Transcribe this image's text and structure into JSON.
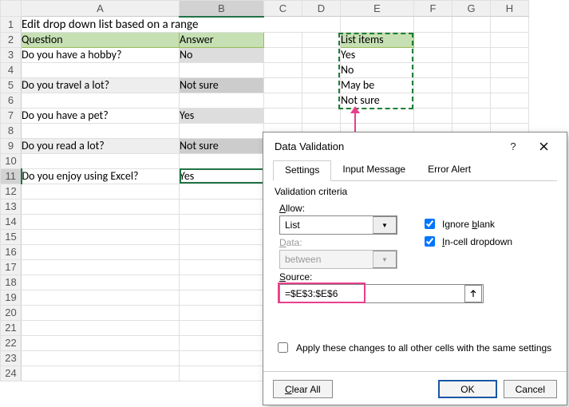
{
  "sheet": {
    "title": "Edit drop down list based on a range",
    "columns": [
      "A",
      "B",
      "C",
      "D",
      "E",
      "F",
      "G",
      "H"
    ],
    "rows_visible": 24,
    "headers": {
      "A2": "Question",
      "B2": "Answer",
      "E2": "List items"
    },
    "questions": {
      "A3": "Do you have a hobby?",
      "A5": "Do you travel a lot?",
      "A7": "Do you have a pet?",
      "A9": "Do you read a lot?",
      "A11": "Do you enjoy using Excel?"
    },
    "answers": {
      "B3": "No",
      "B5": "Not sure",
      "B7": "Yes",
      "B9": "Not sure",
      "B11": "Yes"
    },
    "list_items": {
      "E3": "Yes",
      "E4": "No",
      "E5": "May be",
      "E6": "Not sure"
    },
    "active_cell": "B11",
    "marching_range": "E3:E6"
  },
  "dialog": {
    "title": "Data Validation",
    "help_label": "?",
    "tabs": {
      "settings": "Settings",
      "input_message": "Input Message",
      "error_alert": "Error Alert"
    },
    "active_tab": "settings",
    "criteria_label": "Validation criteria",
    "allow_label_pre": "A",
    "allow_label_post": "llow:",
    "allow_value": "List",
    "data_label_pre": "D",
    "data_label_post": "ata:",
    "data_value": "between",
    "ignore_blank": true,
    "ignore_blank_pre": "Ignore ",
    "ignore_blank_u": "b",
    "ignore_blank_post": "lank",
    "in_cell_dropdown": true,
    "incell_u": "I",
    "incell_post": "n-cell dropdown",
    "source_label_u": "S",
    "source_label_post": "ource:",
    "source_value": "=$E$3:$E$6",
    "apply_all": false,
    "apply_all_pre": "Apply these changes to all other cells with the same settings",
    "clear_all_u": "C",
    "clear_all_post": "lear All",
    "ok": "OK",
    "cancel": "Cancel"
  }
}
